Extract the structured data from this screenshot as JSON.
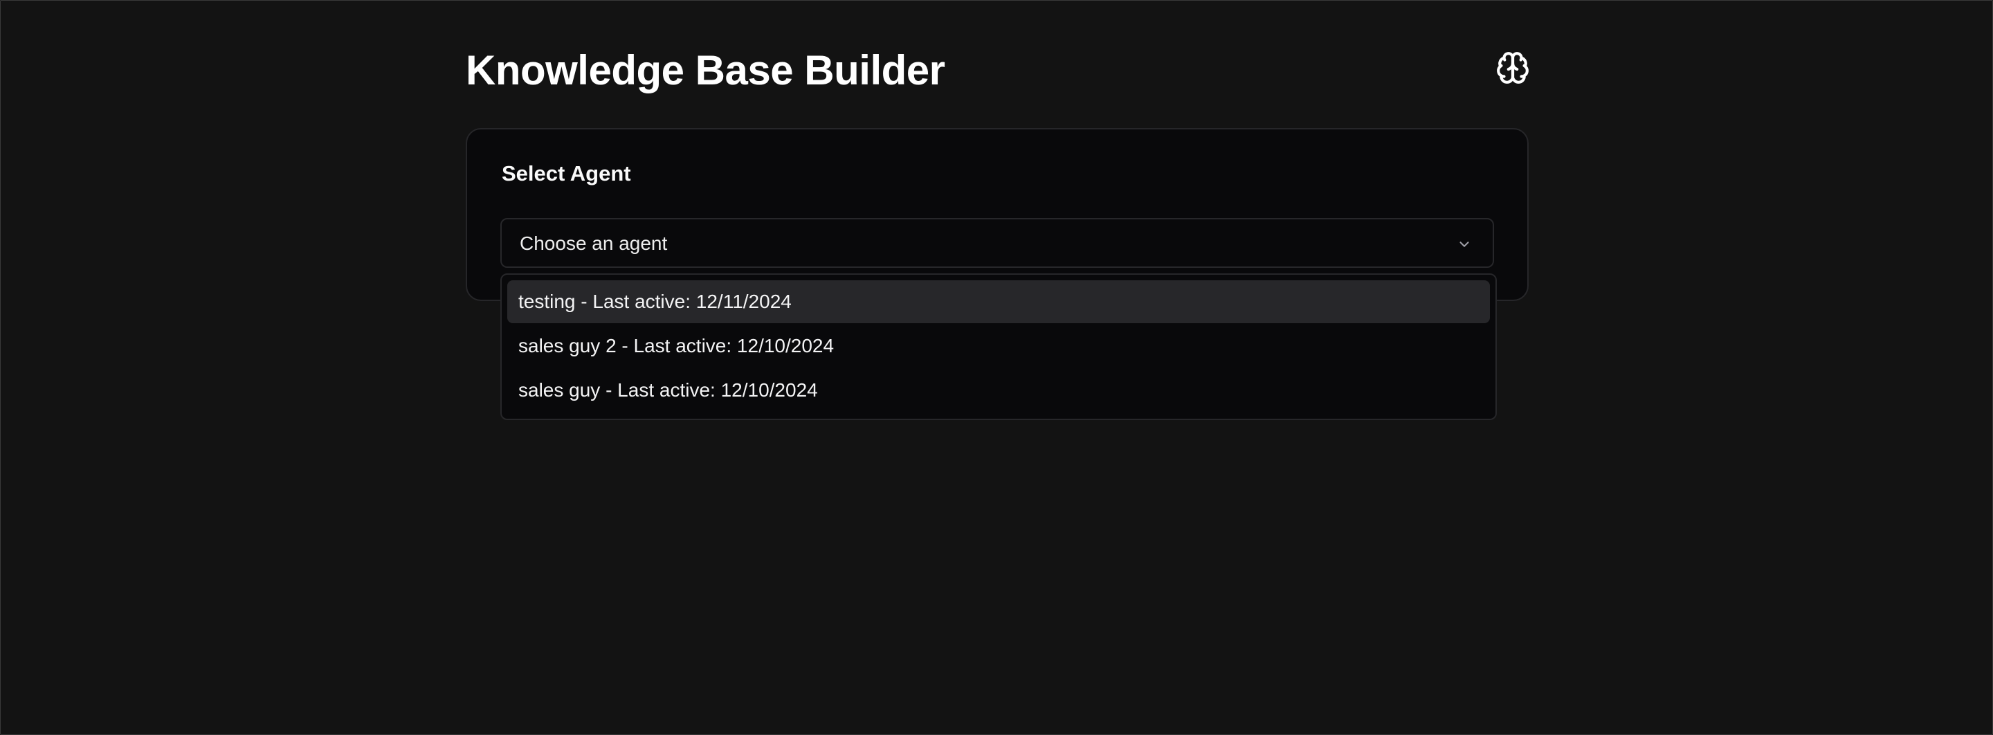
{
  "header": {
    "title": "Knowledge Base Builder",
    "icon": "brain-icon"
  },
  "agent_card": {
    "label": "Select Agent",
    "select": {
      "placeholder": "Choose an agent",
      "icon": "chevron-down-icon",
      "expanded": true
    },
    "options": [
      {
        "label": "testing - Last active: 12/11/2024",
        "highlighted": true
      },
      {
        "label": "sales guy 2 - Last active: 12/10/2024",
        "highlighted": false
      },
      {
        "label": "sales guy - Last active: 12/10/2024",
        "highlighted": false
      }
    ]
  },
  "colors": {
    "background": "#131313",
    "card": "#09090b",
    "border": "#27272a",
    "highlight": "#27272a",
    "text": "#ffffff"
  }
}
